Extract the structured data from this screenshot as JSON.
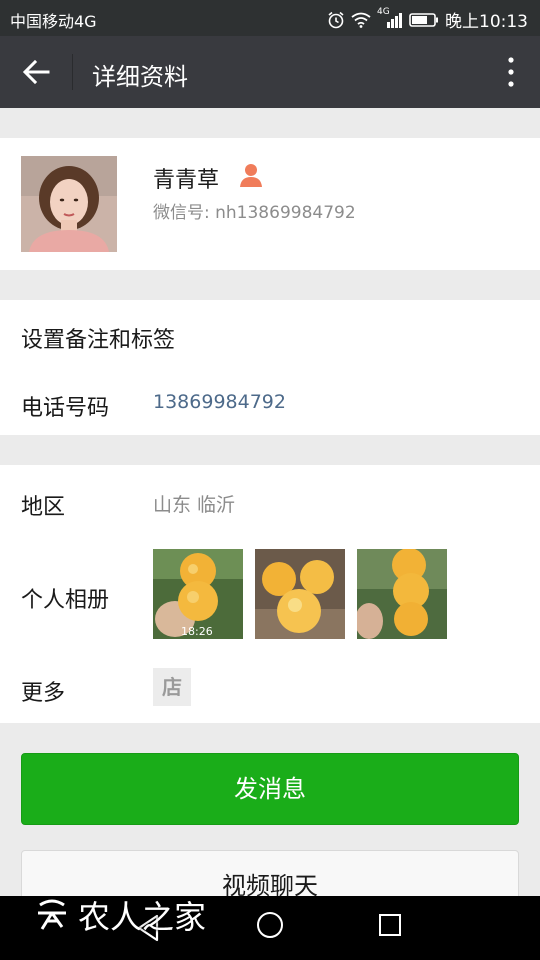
{
  "status_bar": {
    "carrier": "中国移动4G",
    "network_badge": "4G",
    "time": "晚上10:13"
  },
  "title_bar": {
    "title": "详细资料"
  },
  "profile": {
    "name": "青青草",
    "wechat_id": "微信号: nh13869984792"
  },
  "settings": {
    "remark_label": "设置备注和标签",
    "phone_label": "电话号码",
    "phone_value": "13869984792"
  },
  "info": {
    "region_label": "地区",
    "region_value": "山东  临沂",
    "album_label": "个人相册",
    "album_time": "18:26",
    "more_label": "更多",
    "shop_icon": "店"
  },
  "actions": {
    "send_message": "发消息",
    "video_chat": "视频聊天"
  },
  "watermark": {
    "text": "农人之家"
  },
  "colors": {
    "titlebar_bg": "#393a3f",
    "primary_green": "#1aad19",
    "phone_link": "#4d6a8a",
    "gender_icon": "#f07c5a"
  }
}
